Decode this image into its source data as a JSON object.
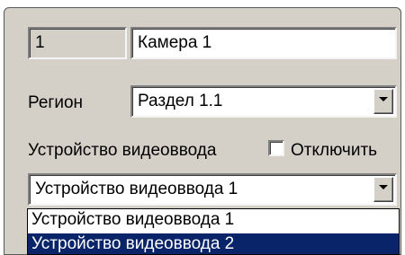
{
  "camera": {
    "id_value": "1",
    "name_value": "Камера 1"
  },
  "region": {
    "label": "Регион",
    "selected": "Раздел 1.1"
  },
  "video_input": {
    "label": "Устройство видеоввода",
    "disable_label": "Отключить",
    "disable_checked": false,
    "selected": "Устройство видеоввода 1",
    "options": [
      "Устройство видеоввода 1",
      "Устройство видеоввода 2"
    ],
    "highlighted_option": "Устройство видеоввода 2"
  }
}
